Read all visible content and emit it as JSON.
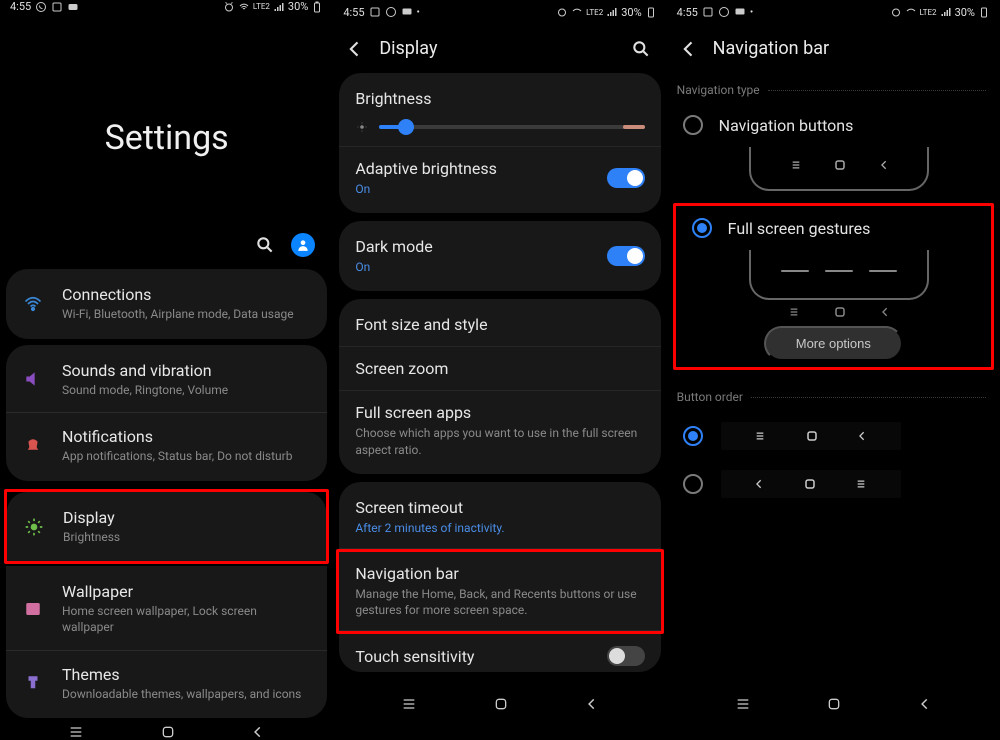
{
  "status": {
    "time": "4:55",
    "battery": "30%",
    "network": "LTE2"
  },
  "screen1": {
    "title": "Settings",
    "items": [
      {
        "title": "Connections",
        "sub": "Wi-Fi, Bluetooth, Airplane mode, Data usage",
        "icon": "wifi",
        "color": "#3a87d6"
      },
      {
        "title": "Sounds and vibration",
        "sub": "Sound mode, Ringtone, Volume",
        "icon": "volume",
        "color": "#8a4dbf"
      },
      {
        "title": "Notifications",
        "sub": "App notifications, Status bar, Do not disturb",
        "icon": "bell",
        "color": "#d9534f"
      },
      {
        "title": "Display",
        "sub": "Brightness",
        "icon": "sun",
        "color": "#6fbf4b"
      },
      {
        "title": "Wallpaper",
        "sub": "Home screen wallpaper, Lock screen wallpaper",
        "icon": "image",
        "color": "#d06fa0"
      },
      {
        "title": "Themes",
        "sub": "Downloadable themes, wallpapers, and icons",
        "icon": "brush",
        "color": "#8a6fd0"
      }
    ]
  },
  "screen2": {
    "header": "Display",
    "brightness_label": "Brightness",
    "brightness_value": 10,
    "adaptive": {
      "title": "Adaptive brightness",
      "status": "On",
      "on": true
    },
    "darkmode": {
      "title": "Dark mode",
      "status": "On",
      "on": true
    },
    "fontstyle": "Font size and style",
    "screenzoom": "Screen zoom",
    "fullscreen": {
      "title": "Full screen apps",
      "sub": "Choose which apps you want to use in the full screen aspect ratio."
    },
    "timeout": {
      "title": "Screen timeout",
      "sub": "After 2 minutes of inactivity."
    },
    "navbar": {
      "title": "Navigation bar",
      "sub": "Manage the Home, Back, and Recents buttons or use gestures for more screen space."
    },
    "touch": "Touch sensitivity"
  },
  "screen3": {
    "header": "Navigation bar",
    "sec_navtype": "Navigation type",
    "opt_buttons": "Navigation buttons",
    "opt_gestures": "Full screen gestures",
    "more_options": "More options",
    "sec_order": "Button order",
    "nav_glyphs": {
      "recents": "|||",
      "home": "○",
      "back": "‹"
    },
    "selected_type": "gestures",
    "selected_order": 0
  }
}
